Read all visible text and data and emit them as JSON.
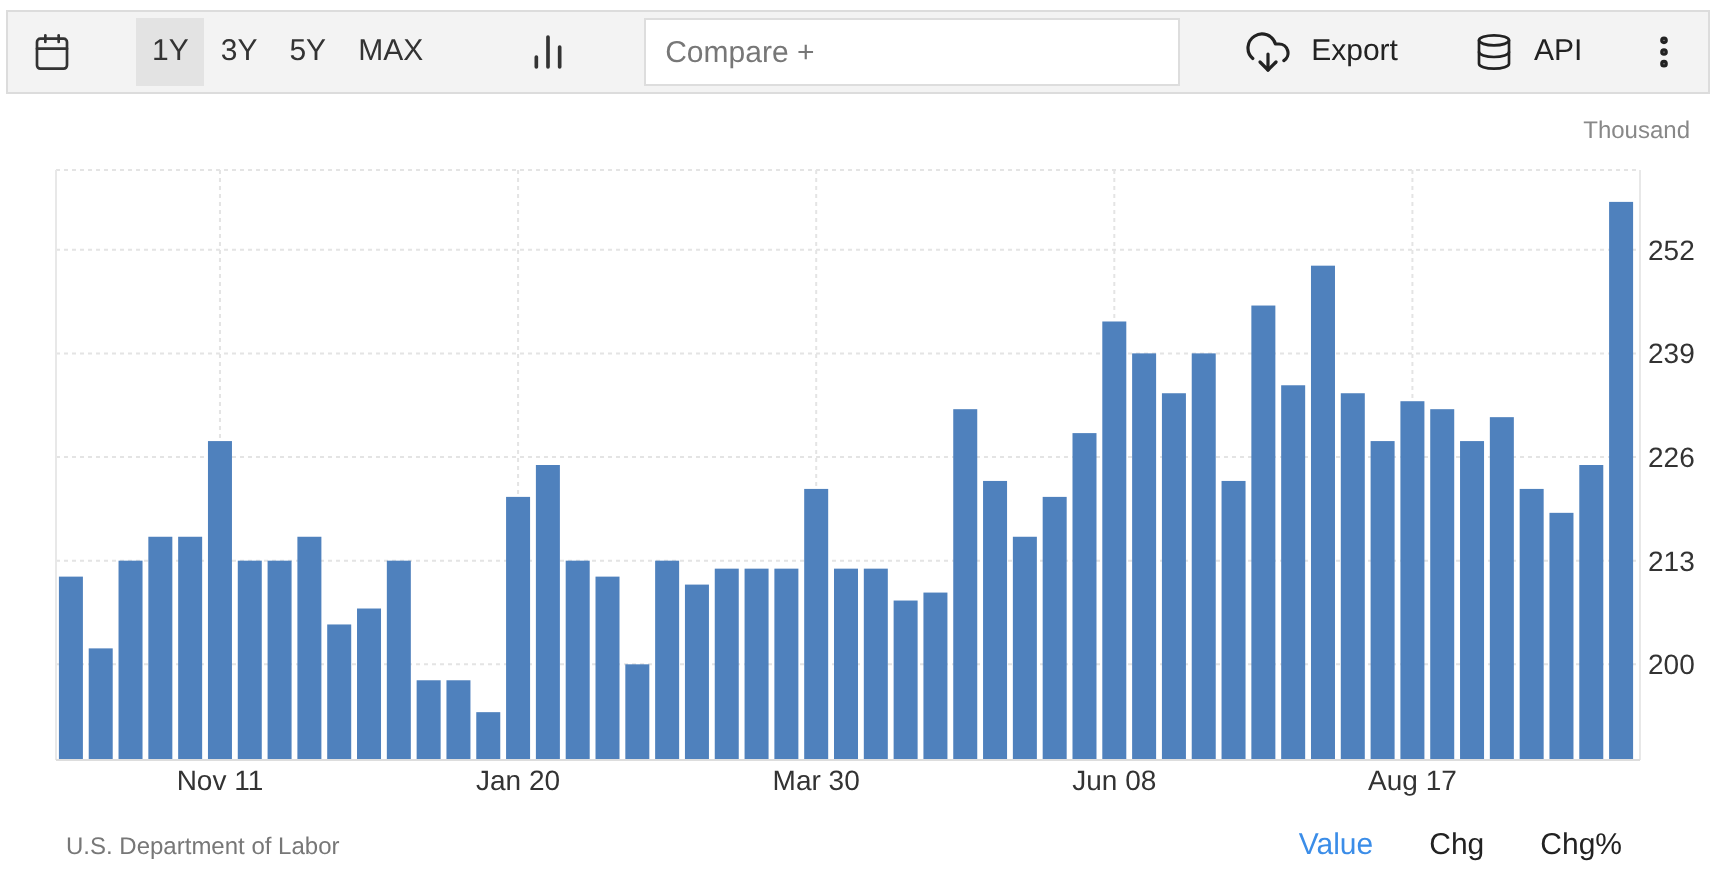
{
  "toolbar": {
    "ranges": [
      {
        "label": "1Y",
        "selected": true
      },
      {
        "label": "3Y",
        "selected": false
      },
      {
        "label": "5Y",
        "selected": false
      },
      {
        "label": "MAX",
        "selected": false
      }
    ],
    "compare": {
      "placeholder": "Compare +"
    },
    "export": "Export",
    "api": "API"
  },
  "chart": {
    "chart_data": {
      "type": "bar",
      "ylabel": "Thousand",
      "ylim": [
        188,
        262
      ],
      "yticks": [
        200,
        213,
        226,
        239,
        252
      ],
      "grid": true,
      "categories": [
        null,
        null,
        null,
        null,
        null,
        "Nov 11",
        null,
        null,
        null,
        null,
        null,
        null,
        null,
        null,
        null,
        "Jan 20",
        null,
        null,
        null,
        null,
        null,
        null,
        null,
        null,
        null,
        "Mar 30",
        null,
        null,
        null,
        null,
        null,
        null,
        null,
        null,
        null,
        "Jun 08",
        null,
        null,
        null,
        null,
        null,
        null,
        null,
        null,
        null,
        "Aug 17",
        null,
        null,
        null,
        null,
        null,
        null,
        null
      ],
      "series": [
        {
          "color": "#4f81bd",
          "values": [
            211,
            202,
            213,
            216,
            216,
            228,
            213,
            213,
            216,
            205,
            207,
            213,
            198,
            198,
            194,
            221,
            225,
            213,
            211,
            200,
            213,
            210,
            212,
            212,
            212,
            222,
            212,
            212,
            208,
            209,
            232,
            223,
            216,
            221,
            229,
            243,
            239,
            234,
            239,
            223,
            245,
            235,
            250,
            234,
            228,
            233,
            232,
            228,
            231,
            222,
            219,
            225,
            258
          ]
        }
      ]
    }
  },
  "footer": {
    "source": "U.S. Department of Labor",
    "views": [
      {
        "label": "Value",
        "selected": true
      },
      {
        "label": "Chg",
        "selected": false
      },
      {
        "label": "Chg%",
        "selected": false
      }
    ]
  }
}
